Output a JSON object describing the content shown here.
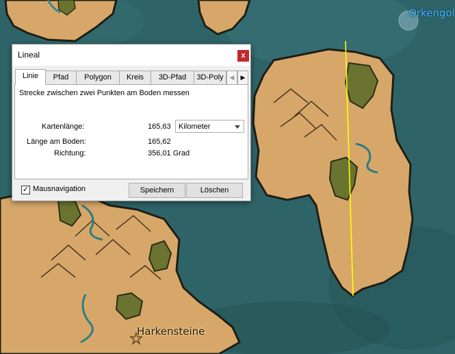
{
  "map": {
    "places": [
      {
        "name": "Orkengold"
      },
      {
        "name": "Harkensteine"
      }
    ],
    "ruler_line_color": "#ffff00"
  },
  "dialog": {
    "title": "Lineal",
    "close_label": "x",
    "tabs": [
      {
        "label": "Linie",
        "active": true
      },
      {
        "label": "Pfad"
      },
      {
        "label": "Polygon"
      },
      {
        "label": "Kreis"
      },
      {
        "label": "3D-Pfad"
      },
      {
        "label": "3D-Poly"
      }
    ],
    "description": "Strecke zwischen zwei Punkten am Boden messen",
    "map_length_label": "Kartenlänge:",
    "map_length_value": "165,63",
    "unit": "Kilometer",
    "ground_length_label": "Länge am Boden:",
    "ground_length_value": "165,62",
    "heading_label": "Richtung:",
    "heading_value": "356,01 Grad",
    "mouse_nav_label": "Mausnavigation",
    "mouse_nav_checked": true,
    "save_label": "Speichern",
    "clear_label": "Löschen"
  }
}
